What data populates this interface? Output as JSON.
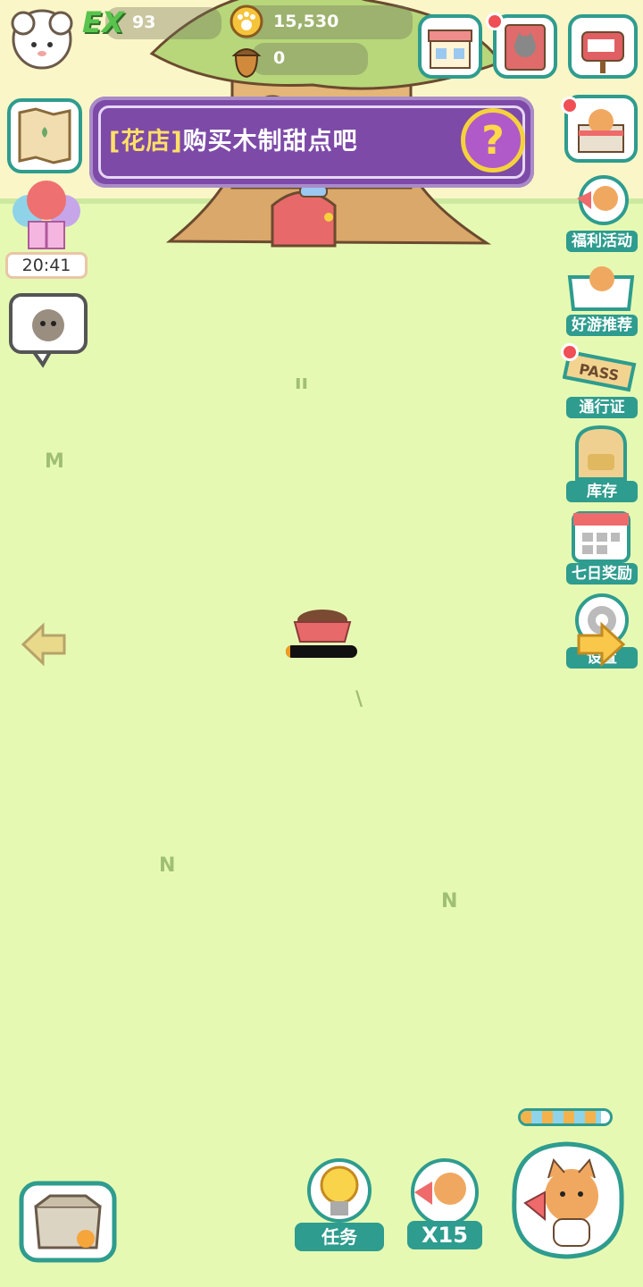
{
  "currency": {
    "ex_label": "EX",
    "ex_value": "93",
    "coins_value": "15,530",
    "acorns_value": "0"
  },
  "banner": {
    "tag": "[花店]",
    "text": "购买木制甜点吧",
    "help_glyph": "?"
  },
  "timer": "20:41",
  "right_menu": {
    "welfare": "福利活动",
    "games": "好游推荐",
    "pass": "通行证",
    "pass_ticket": "PASS",
    "inventory": "库存",
    "seven_day": "七日奖励",
    "settings_partial": "设置"
  },
  "bottom_bar": {
    "tasks_label": "任务",
    "multiplier_label": "X15",
    "progress_fill": 0.9
  },
  "food_bowl": {
    "progress": 0.06
  },
  "colors": {
    "grass": "#e6f9b3",
    "teal": "#2e9c8e",
    "banner": "#7d4aa8",
    "accent_yellow": "#f5d23c",
    "badge_red": "#ef4f55"
  },
  "icons": {
    "avatar": "sheep-avatar-icon",
    "ex": "experience-icon",
    "coin": "paw-coin-icon",
    "acorn": "acorn-icon",
    "shop": "shop-icon",
    "album": "cat-album-icon",
    "mail": "mailbox-icon",
    "map": "map-icon",
    "balloon": "balloon-gift-icon",
    "cat_chat": "cat-chat-icon",
    "cat_box": "cat-box-icon",
    "welfare": "megaphone-cat-icon",
    "games": "cat-gift-box-icon",
    "pass": "pass-ticket-icon",
    "inventory": "backpack-icon",
    "calendar": "calendar-icon",
    "settings": "gear-icon",
    "left_arrow": "arrow-left-icon",
    "right_arrow": "arrow-right-icon",
    "storage": "cardboard-box-icon",
    "task": "lightbulb-icon",
    "cat_helper": "cat-megaphone-icon",
    "main_cat": "main-cat-icon",
    "food": "food-bowl-icon"
  }
}
